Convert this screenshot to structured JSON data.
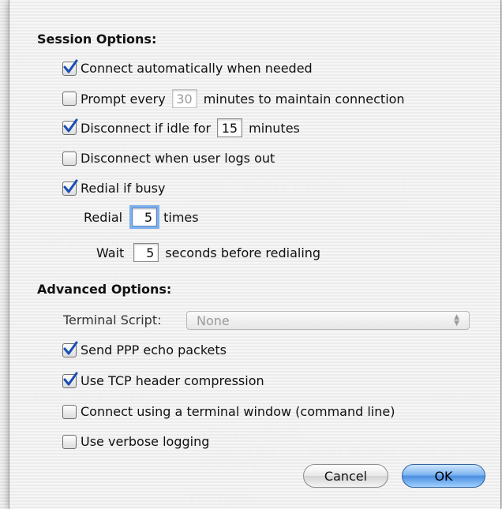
{
  "session": {
    "title": "Session Options:",
    "connect_auto": {
      "label": "Connect automatically when needed",
      "checked": true
    },
    "prompt": {
      "label_before": "Prompt every",
      "value": "30",
      "label_after": "minutes to maintain connection",
      "checked": false
    },
    "disconnect_idle": {
      "label_before": "Disconnect if idle for",
      "value": "15",
      "label_after": "minutes",
      "checked": true
    },
    "disconnect_logout": {
      "label": "Disconnect when user logs out",
      "checked": false
    },
    "redial_busy": {
      "label": "Redial if busy",
      "checked": true
    },
    "redial_times": {
      "label_before": "Redial",
      "value": "5",
      "label_after": "times"
    },
    "wait": {
      "label_before": "Wait",
      "value": "5",
      "label_after": "seconds before redialing"
    }
  },
  "advanced": {
    "title": "Advanced Options:",
    "terminal_script": {
      "label": "Terminal Script:",
      "value": "None"
    },
    "ppp_echo": {
      "label": "Send PPP echo packets",
      "checked": true
    },
    "tcp_compression": {
      "label": "Use TCP header compression",
      "checked": true
    },
    "terminal_window": {
      "label": "Connect using a terminal window (command line)",
      "checked": false
    },
    "verbose": {
      "label": "Use verbose logging",
      "checked": false
    }
  },
  "buttons": {
    "cancel": "Cancel",
    "ok": "OK"
  },
  "colors": {
    "check": "#1a4fb4",
    "focus_ring": "#7fb0ec",
    "ok_button": "#4b8de0"
  }
}
